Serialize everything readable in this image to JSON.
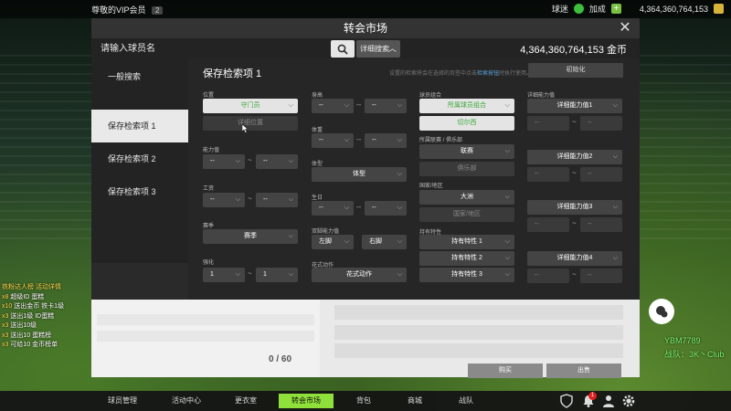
{
  "topbar": {
    "vip_text": "尊敬的VIP会员",
    "vip_badge": "2",
    "label1": "球迷",
    "label2": "加成",
    "money": "4,364,360,764,153"
  },
  "modal": {
    "title": "转会市场",
    "search_placeholder": "请输入球员名",
    "advanced_search": "详细搜索",
    "coins": "4,364,360,764,153 金币"
  },
  "sidebar": {
    "items": [
      {
        "label": "一般搜索"
      },
      {
        "label": "保存检索项 1"
      },
      {
        "label": "保存检索项 2"
      },
      {
        "label": "保存检索项 3"
      }
    ]
  },
  "panel": {
    "title": "保存检索项 1",
    "hint_prefix": "设置的检索将会在选择的页签中点击",
    "hint_highlight": "检索按钮",
    "hint_suffix": "时执行使用。",
    "reset": "初始化",
    "col1": {
      "position_label": "位置",
      "position_value": "守门员",
      "detail_position": "详细位置",
      "ability_label": "能力值",
      "salary_label": "工资",
      "season_label": "赛季",
      "season_value": "赛季",
      "upgrade_label": "强化",
      "upgrade_min": "1",
      "upgrade_max": "1"
    },
    "col2": {
      "height_label": "身高",
      "weight_label": "体重",
      "body_label": "体型",
      "body_value": "体型",
      "birthday_label": "生日",
      "foot_label": "双脚能力值",
      "foot_left": "左脚",
      "foot_right": "右脚",
      "skill_label": "花式动作",
      "skill_value": "花式动作"
    },
    "col3": {
      "combo_label": "球员组合",
      "combo_value": "所属球员组合",
      "combo_sub": "切尔西",
      "team_label": "所属联赛 / 俱乐部",
      "league_value": "联赛",
      "club_value": "俱乐部",
      "nation_label": "国家/地区",
      "continent_value": "大洲",
      "nation_value": "国家/地区",
      "trait_label": "持有特性",
      "trait1": "持有特性 1",
      "trait2": "持有特性 2",
      "trait3": "持有特性 3"
    },
    "col4": {
      "label": "详细能力值",
      "d1": "详细能力值1",
      "d2": "详细能力值2",
      "d3": "详细能力值3",
      "d4": "详细能力值4"
    },
    "dash": "--",
    "tilde": "~"
  },
  "lower": {
    "count": "0 / 60",
    "buy": "购买",
    "sell": "出售"
  },
  "chat": {
    "lines": [
      {
        "n": "",
        "t": "铁粉达人榜 活动详情"
      },
      {
        "n": "x8",
        "t": " 超级ID 蛋糕"
      },
      {
        "n": "x10",
        "t": " 送出金币 铁卡1级"
      },
      {
        "n": "x3",
        "t": " 送出1级 ID蛋糕"
      },
      {
        "n": "x3",
        "t": " 送出10级"
      },
      {
        "n": "x3",
        "t": " 送出10 蛋糕榜"
      },
      {
        "n": "x3",
        "t": " 可给10 金币榜单"
      }
    ]
  },
  "overlay": {
    "line1": "YBM7789",
    "line2": "战队：3K丶Club"
  },
  "nav": {
    "items": [
      "球员管理",
      "活动中心",
      "更衣室",
      "转会市场",
      "背包",
      "商城",
      "战队"
    ],
    "badge": "1"
  }
}
